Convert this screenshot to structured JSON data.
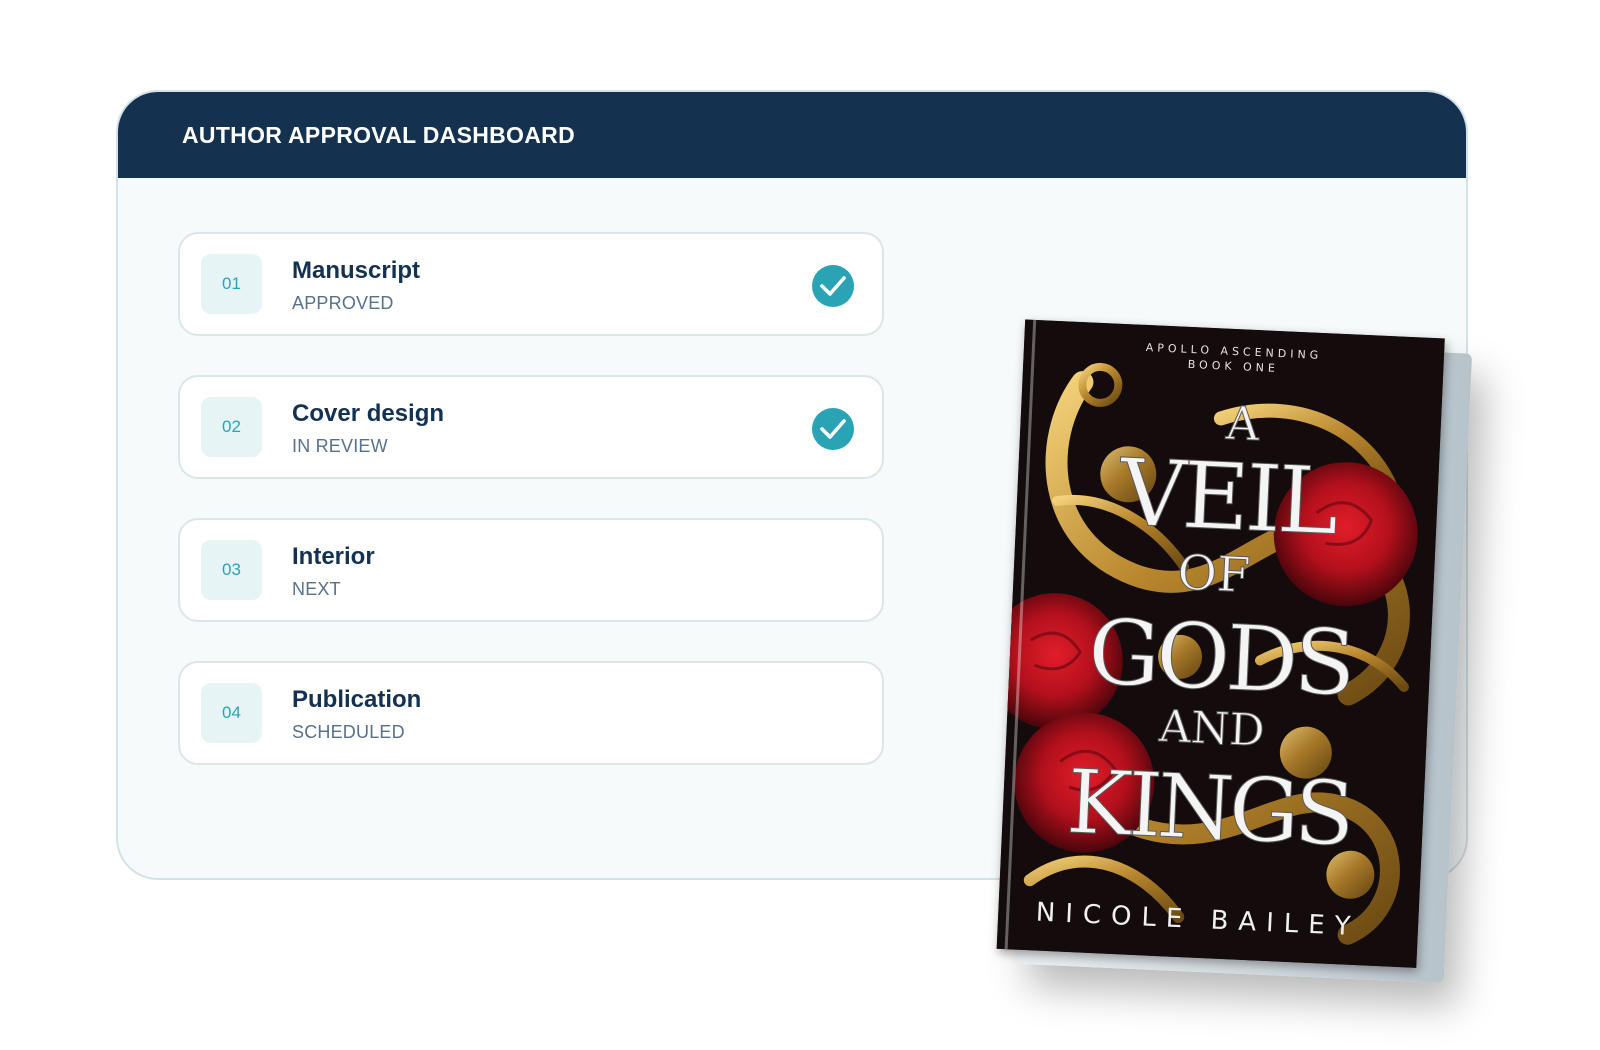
{
  "dashboard": {
    "title": "AUTHOR APPROVAL DASHBOARD",
    "steps": [
      {
        "number": "01",
        "title": "Manuscript",
        "status": "APPROVED",
        "checked": true
      },
      {
        "number": "02",
        "title": "Cover design",
        "status": "IN REVIEW",
        "checked": true
      },
      {
        "number": "03",
        "title": "Interior",
        "status": "NEXT",
        "checked": false
      },
      {
        "number": "04",
        "title": "Publication",
        "status": "SCHEDULED",
        "checked": false
      }
    ]
  },
  "book": {
    "series": "APOLLO ASCENDING",
    "series_book": "BOOK ONE",
    "title_line1": "A",
    "title_line2": "VEIL",
    "title_line3": "OF",
    "title_line4": "GODS",
    "title_line5": "AND",
    "title_line6": "KINGS",
    "author": "NICOLE BAILEY"
  },
  "colors": {
    "header_bg": "#14314f",
    "accent": "#2aa3b5",
    "panel_bg": "#f6fafb"
  },
  "icons": {
    "check": "check-circle-icon"
  }
}
